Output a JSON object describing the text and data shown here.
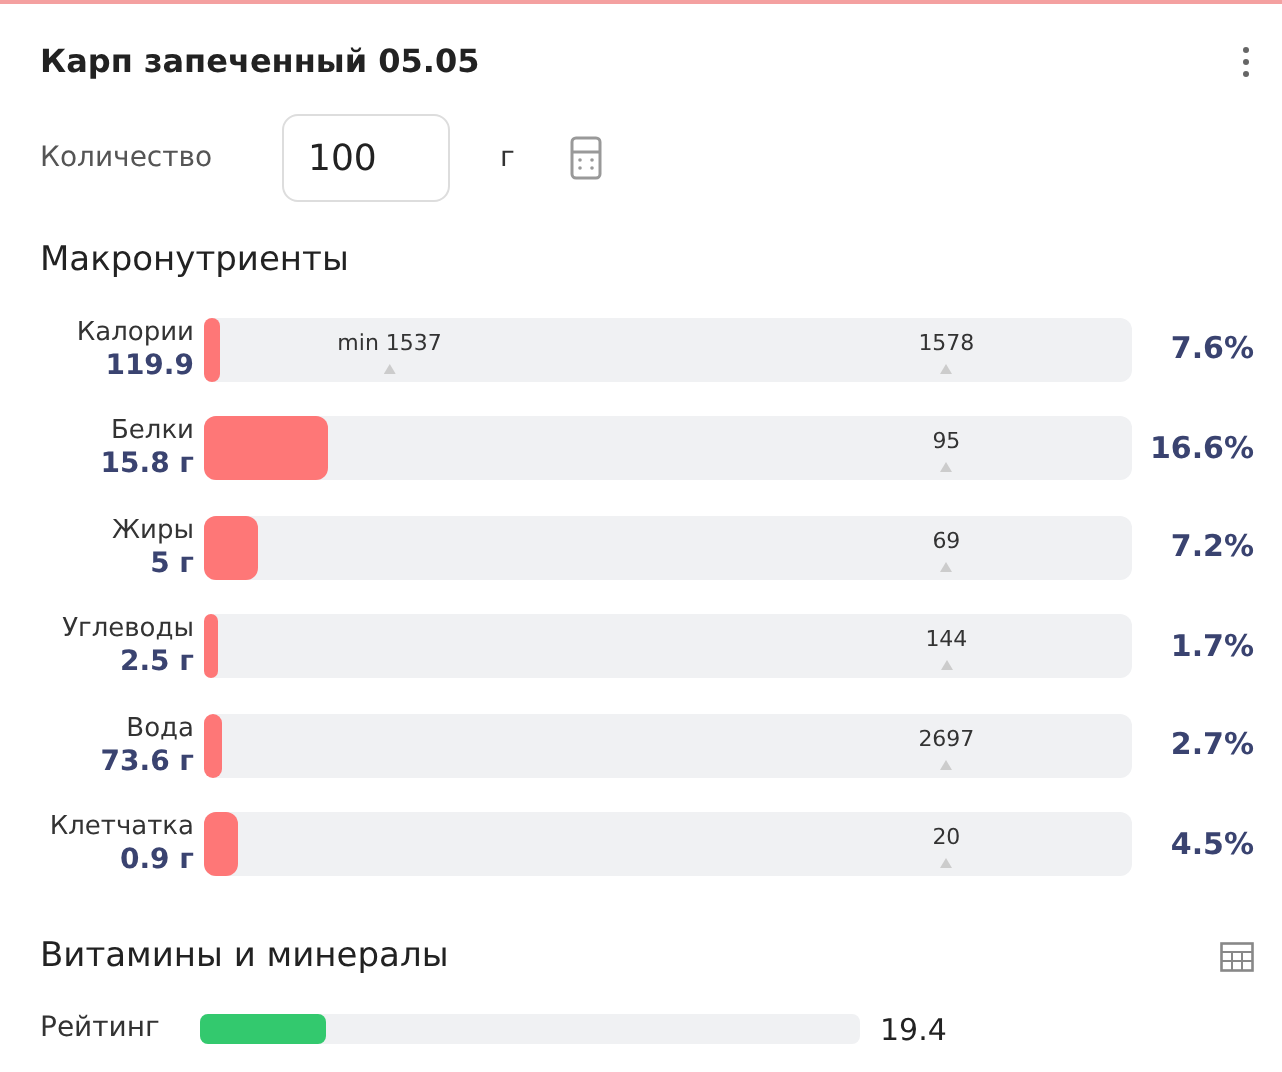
{
  "title": "Карп запеченный 05.05",
  "quantity": {
    "label": "Количество",
    "value": "100",
    "unit": "г"
  },
  "macros": {
    "heading": "Макронутриенты",
    "rows": [
      {
        "name": "Калории",
        "amount": "119.9",
        "level": 0.017,
        "percent": "7.6%",
        "markers": [
          {
            "kind": "min",
            "text": "min 1537"
          },
          {
            "kind": "target",
            "text": "1578"
          }
        ]
      },
      {
        "name": "Белки",
        "amount": "15.8 г",
        "level": 0.134,
        "percent": "16.6%",
        "markers": [
          {
            "kind": "target",
            "text": "95"
          }
        ]
      },
      {
        "name": "Жиры",
        "amount": "5 г",
        "level": 0.058,
        "percent": "7.2%",
        "markers": [
          {
            "kind": "target",
            "text": "69"
          }
        ]
      },
      {
        "name": "Углеводы",
        "amount": "2.5 г",
        "level": 0.015,
        "percent": "1.7%",
        "markers": [
          {
            "kind": "target",
            "text": "144"
          }
        ]
      },
      {
        "name": "Вода",
        "amount": "73.6 г",
        "level": 0.02,
        "percent": "2.7%",
        "markers": [
          {
            "kind": "target",
            "text": "2697"
          }
        ]
      },
      {
        "name": "Клетчатка",
        "amount": "0.9 г",
        "level": 0.037,
        "percent": "4.5%",
        "markers": [
          {
            "kind": "target",
            "text": "20"
          }
        ]
      }
    ]
  },
  "vitamins": {
    "heading": "Витамины и минералы",
    "rating": {
      "label": "Рейтинг",
      "level": 0.19,
      "value": "19.4"
    }
  }
}
